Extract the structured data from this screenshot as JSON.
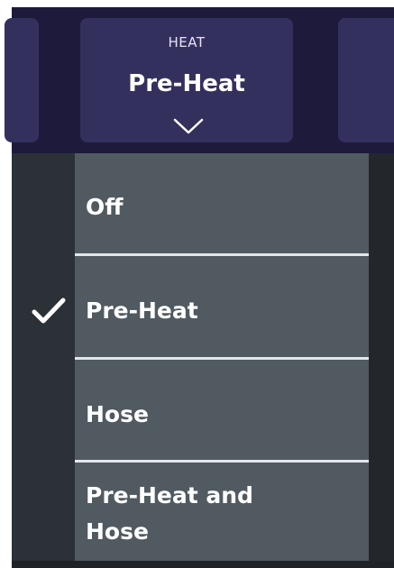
{
  "header": {
    "caption": "HEAT",
    "value": "Pre-Heat"
  },
  "dropdown": {
    "selected": "Pre-Heat",
    "options": [
      {
        "label": "Off"
      },
      {
        "label": "Pre-Heat"
      },
      {
        "label": "Hose"
      },
      {
        "label": "Pre-Heat and Hose"
      }
    ]
  },
  "icons": {
    "chevron": "chevron-down-icon",
    "check": "checkmark-icon"
  },
  "colors": {
    "topbar": "#1d1a3b",
    "tile": "#34305e",
    "panel": "#2b3137",
    "option_bg": "#515a61",
    "divider": "#e4e7ea",
    "text": "#ffffff"
  }
}
